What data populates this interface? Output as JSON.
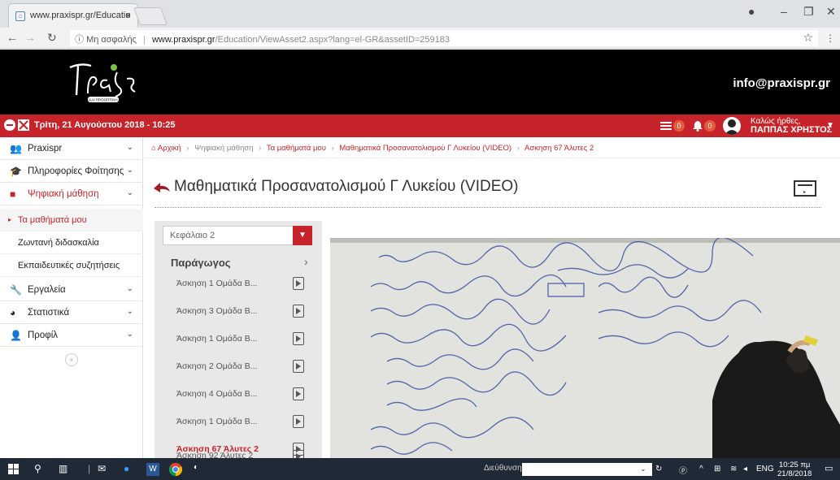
{
  "browser": {
    "tab_title": "www.praxispr.gr/Educatio",
    "tab_close": "×",
    "not_secure": "Μη ασφαλής",
    "url_domain": "www.praxispr.gr",
    "url_path": "/Education/ViewAsset2.aspx?lang=el-GR&assetID=259183"
  },
  "header": {
    "email": "info@praxispr.gr",
    "logo_tagline": "ΚΑΙ ΠΡΟΟΠΤΙΚΗ"
  },
  "topbar": {
    "date": "Τρίτη, 21 Αυγούστου 2018 - 10:25",
    "messages_count": "0",
    "notifications_count": "0",
    "welcome": "Καλώς ήρθες,",
    "user_name": "ΠΑΠΠΑΣ ΧΡΗΣΤΟΣ"
  },
  "sidebar": {
    "items": [
      {
        "label": "Praxispr"
      },
      {
        "label": "Πληροφορίες Φοίτησης"
      },
      {
        "label": "Ψηφιακή μάθηση"
      },
      {
        "label": "Τα μαθήματά μου"
      },
      {
        "label": "Ζωντανή διδασκαλία"
      },
      {
        "label": "Εκπαιδευτικές συζητήσεις"
      },
      {
        "label": "Εργαλεία"
      },
      {
        "label": "Στατιστικά"
      },
      {
        "label": "Προφίλ"
      }
    ]
  },
  "breadcrumb": {
    "home": "Αρχική",
    "b1": "Ψηφιακή μάθηση",
    "b2": "Τα μαθήματά μου",
    "b3": "Μαθηματικά Προσανατολισμού Γ Λυκείου (VIDEO)",
    "b4": "Ασκηση 67 Άλυτες 2"
  },
  "page_title": "Μαθηματικά Προσανατολισμού Γ Λυκείου (VIDEO)",
  "panel": {
    "chapter": "Κεφάλαιο 2",
    "section": "Παράγωγος",
    "lessons": [
      {
        "label": "Άσκηση 1 Ομάδα Β..."
      },
      {
        "label": "Άσκηση 3 Ομάδα Β..."
      },
      {
        "label": "Άσκηση 1 Ομάδα Β..."
      },
      {
        "label": "Άσκηση 2 Ομάδα Β..."
      },
      {
        "label": "Άσκηση 4 Ομάδα Β..."
      },
      {
        "label": "Άσκηση 1 Ομάδα Β..."
      },
      {
        "label": "Άσκηση 67 Άλυτες 2"
      },
      {
        "label": "Άσκηση 92 Άλυτες 2"
      }
    ]
  },
  "taskbar": {
    "address_label": "Διεύθυνση",
    "language": "ENG",
    "time": "10:25 πμ",
    "date": "21/8/2018"
  },
  "colors": {
    "brand_red": "#c6242a",
    "header_black": "#000000",
    "taskbar": "#1f2a36"
  }
}
